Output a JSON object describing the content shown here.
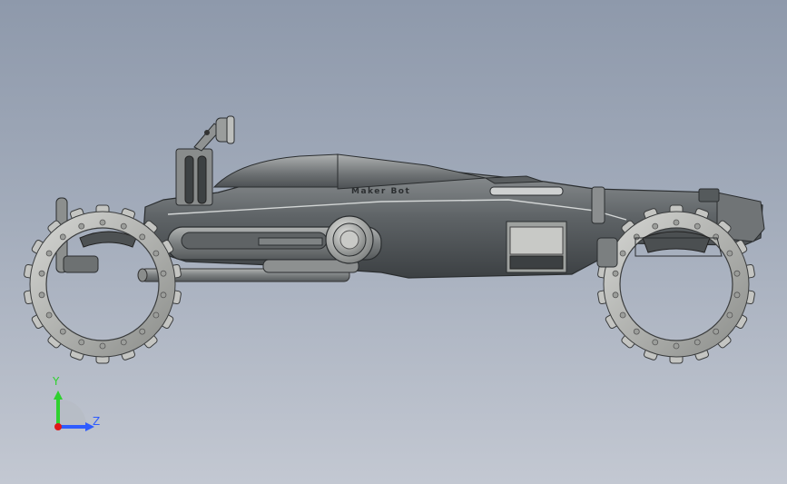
{
  "viewport": {
    "background_top": "#8e99ab",
    "background_bottom": "#c3c8d2"
  },
  "model": {
    "name_plate": "Maker Bot",
    "body_color": "#6b6f72",
    "tire_color": "#b4b5b3"
  },
  "triad": {
    "y_label": "Y",
    "z_label": "Z",
    "y_color": "#2fd12f",
    "z_color": "#2f5cff",
    "origin_color": "#e01818"
  }
}
